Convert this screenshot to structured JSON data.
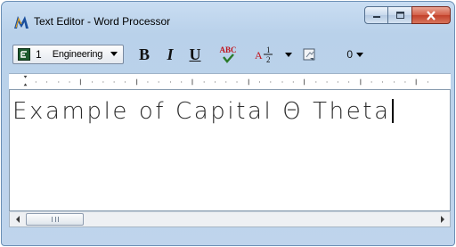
{
  "window": {
    "title": "Text Editor - Word Processor",
    "app_icon": "microstation-m-icon",
    "controls": [
      "minimize-icon",
      "maximize-icon",
      "close-icon"
    ]
  },
  "toolbar": {
    "font_number": "1",
    "font_name": "Engineering",
    "bold_label": "B",
    "italic_label": "I",
    "underline_label": "U",
    "spell_label": "ABC",
    "fraction": {
      "whole": "A",
      "numerator": "1",
      "denominator": "2"
    },
    "number_label": "0",
    "icons": [
      "font-type-icon",
      "spell-check-icon",
      "fraction-icon",
      "insert-field-icon"
    ]
  },
  "editor": {
    "text": "Example of Capital Θ Theta"
  },
  "colors": {
    "frame": "#bfd4ec",
    "close_button": "#c2412a",
    "spell_red": "#c0141c",
    "spell_check": "#2a7a2a"
  }
}
